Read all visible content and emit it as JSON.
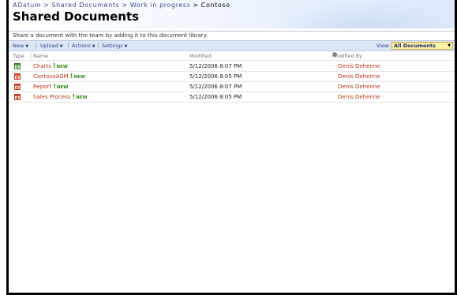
{
  "breadcrumb": [
    {
      "label": "ADatum",
      "link": true
    },
    {
      "label": "Shared Documents",
      "link": true
    },
    {
      "label": "Work in progress",
      "link": true
    },
    {
      "label": "Contoso",
      "link": false
    }
  ],
  "breadcrumb_separator": ">",
  "page_title": "Shared Documents",
  "description": "Share a document with the team by adding it to this document library.",
  "toolbar": {
    "new_label": "New",
    "upload_label": "Upload",
    "actions_label": "Actions",
    "settings_label": "Settings",
    "view_label": "View:",
    "view_value": "All Documents"
  },
  "columns": {
    "type": "Type",
    "name": "Name",
    "modified": "Modified",
    "modified_by": "Modified By"
  },
  "new_badge": "NEW",
  "new_badge_mark": "!",
  "documents": [
    {
      "icon": "excel-icon",
      "name": "Charts",
      "is_new": true,
      "modified": "5/12/2006 8:07 PM",
      "modified_by": "Denis Dehenne"
    },
    {
      "icon": "powerpoint-icon",
      "name": "ContosoAGM",
      "is_new": true,
      "modified": "5/12/2006 8:05 PM",
      "modified_by": "Denis Dehenne"
    },
    {
      "icon": "powerpoint-icon",
      "name": "Report",
      "is_new": true,
      "modified": "5/12/2006 8:07 PM",
      "modified_by": "Denis Dehenne"
    },
    {
      "icon": "powerpoint-icon",
      "name": "Sales Process",
      "is_new": true,
      "modified": "5/12/2006 8:05 PM",
      "modified_by": "Denis Dehenne"
    }
  ],
  "colors": {
    "link": "#3b4f8b",
    "item_link": "#c03a1c",
    "new_badge": "#2e8b14",
    "toolbar_bg": "#dce6f5",
    "view_select_bg": "#fff1a8"
  }
}
